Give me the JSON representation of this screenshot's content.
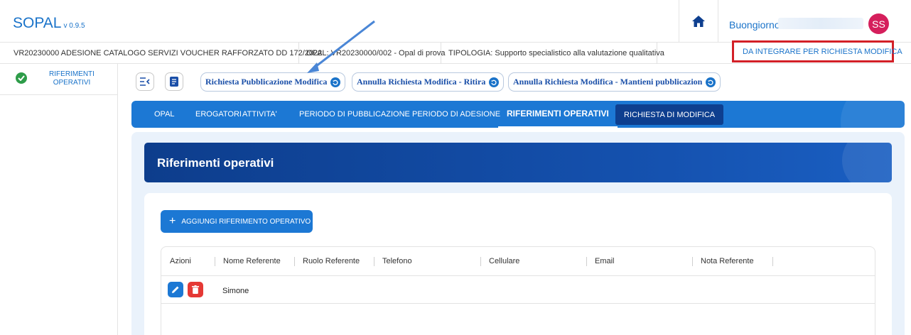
{
  "header": {
    "app_name": "SOPAL",
    "version": "v 0.9.5",
    "greeting": "Buongiorno",
    "avatar_initials": "SS",
    "home_icon": "home-icon"
  },
  "infobar": {
    "catalog": "VR20230000 ADESIONE CATALOGO SERVIZI VOUCHER RAFFORZATO DD 172/2022",
    "opal": "OPAL: VR20230000/002 - Opal di prova",
    "tipologia": "TIPOLOGIA: Supporto specialistico alla valutazione qualitativa",
    "status": "DA INTEGRARE PER RICHIESTA MODIFICA",
    "status_color": "#f2a20c"
  },
  "sidebar": {
    "items": [
      {
        "label": "RIFERIMENTI OPERATIVI",
        "icon": "check-circle-icon"
      }
    ]
  },
  "toolbar": {
    "actions": [
      {
        "label": "Richiesta Pubblicazione Modifica"
      },
      {
        "label": "Annulla Richiesta Modifica - Ritira"
      },
      {
        "label": "Annulla Richiesta Modifica - Mantieni pubblicazion"
      }
    ]
  },
  "tabs": [
    {
      "label": "OPAL"
    },
    {
      "label": "EROGATORI"
    },
    {
      "label": "ATTIVITA'"
    },
    {
      "label": "PERIODO DI PUBBLICAZIONE"
    },
    {
      "label": "PERIODO DI ADESIONE"
    },
    {
      "label": "RIFERIMENTI OPERATIVI"
    },
    {
      "label": "RICHIESTA DI MODIFICA"
    }
  ],
  "section": {
    "title": "Riferimenti operativi",
    "add_button": "AGGIUNGI RIFERIMENTO OPERATIVO"
  },
  "table": {
    "columns": [
      "Azioni",
      "Nome Referente",
      "Ruolo Referente",
      "Telefono",
      "Cellulare",
      "Email",
      "Nota Referente"
    ],
    "rows": [
      {
        "nome": "Simone"
      }
    ]
  },
  "colors": {
    "primary": "#1c78d4",
    "dark_blue": "#0e3f8f",
    "highlight_border": "#d32027",
    "delete": "#e53935"
  }
}
